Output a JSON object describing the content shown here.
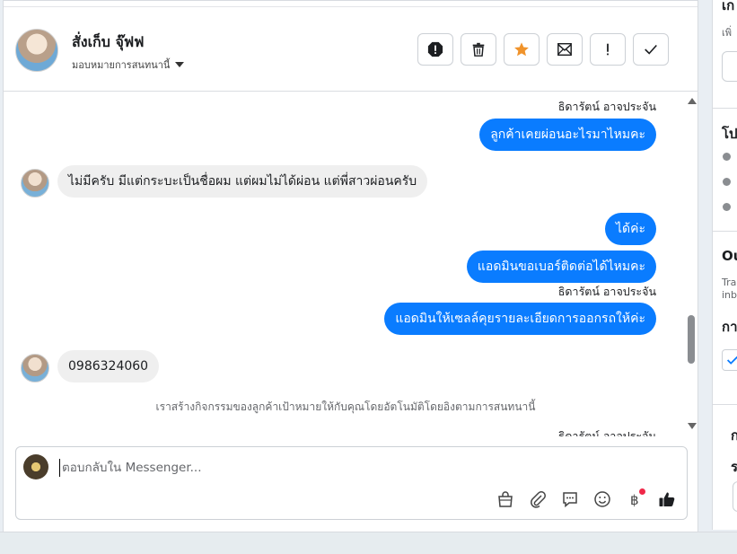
{
  "header": {
    "contact_name": "สั่งเก็บ จุ๊ฟฟ",
    "assign_label": "มอบหมายการสนทนานี้",
    "tools": [
      {
        "name": "spam-icon"
      },
      {
        "name": "trash-icon"
      },
      {
        "name": "star-icon",
        "color": "#f0932b"
      },
      {
        "name": "mark-unread-icon"
      },
      {
        "name": "follow-up-icon"
      },
      {
        "name": "done-icon"
      }
    ]
  },
  "messages": {
    "sender_top": "ธิดารัตน์ อาจประจัน",
    "out_1": "ลูกค้าเคยผ่อนอะไรมาไหมคะ",
    "in_1": "ไม่มีครับ มีแต่กระบะเป็นชื่อผม แต่ผมไม่ได้ผ่อน แต่พี่สาวผ่อนครับ",
    "out_2": "ได้ค่ะ",
    "out_3": "แอดมินขอเบอร์ติดต่อได้ไหมคะ",
    "sender_mid": "ธิดารัตน์ อาจประจัน",
    "out_4": "แอดมินให้เซลล์คุยรายละเอียดการออกรถให้ค่ะ",
    "in_2": "0986324060",
    "system_note": "เราสร้างกิจกรรมของลูกค้าเป้าหมายให้กับคุณโดยอัตโนมัติโดยอิงตามการสนทนานี้",
    "sender_bottom": "ธิดารัตน์ อาจประจัน"
  },
  "composer": {
    "placeholder": "ตอบกลับใน Messenger...",
    "tools": [
      "shopping-bag-icon",
      "attachment-icon",
      "saved-reply-icon",
      "emoji-icon",
      "baht-payment-icon",
      "thumbs-up-icon"
    ]
  },
  "colors": {
    "accent": "#0a7cff",
    "incoming_bubble": "#efefef"
  },
  "side_panel": {
    "heading_1": "เก",
    "sub_1": "เพิ่",
    "heading_2": "โป",
    "heading_3": "Ou",
    "sub_3a": "Trac",
    "sub_3b": "inbo",
    "heading_4": "กา",
    "heading_5": "ก",
    "heading_6": "ร"
  }
}
